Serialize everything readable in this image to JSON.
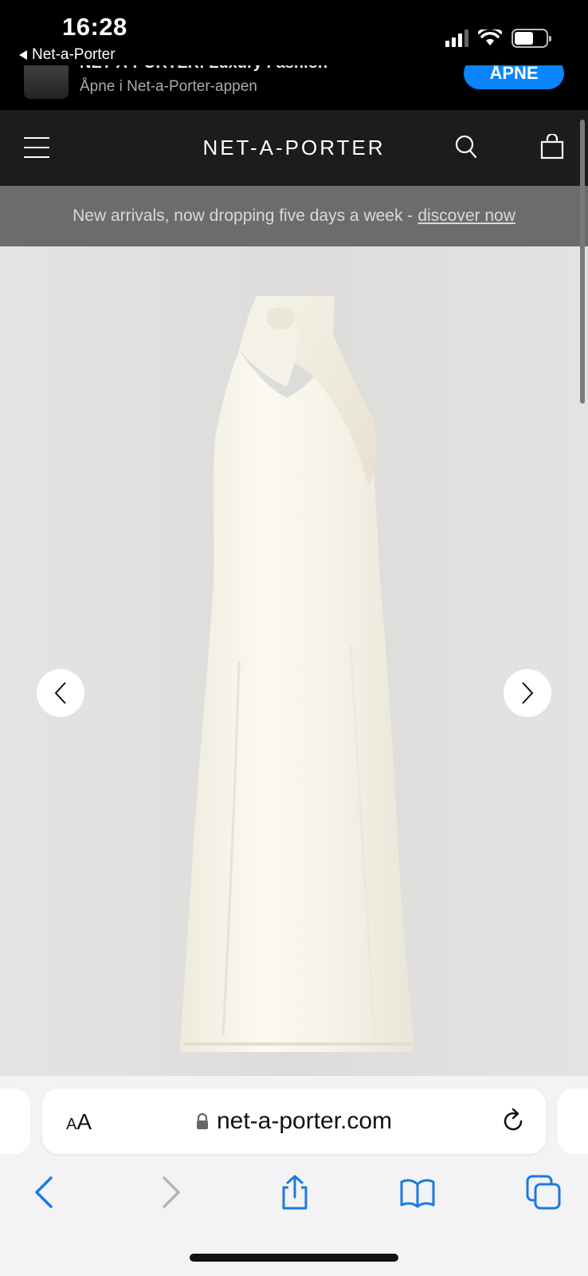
{
  "status_bar": {
    "time": "16:28",
    "back_app": "Net-a-Porter"
  },
  "app_banner": {
    "title": "NET-A-PORTER: Luxury Fashion",
    "subtitle": "Åpne i Net-a-Porter-appen",
    "open_label": "ÅPNE"
  },
  "header": {
    "logo": "NET-A-PORTER"
  },
  "promo": {
    "text": "New arrivals, now dropping five days a week -",
    "link": "discover now"
  },
  "browser": {
    "aa_small": "A",
    "aa_large": "A",
    "url": "net-a-porter.com"
  },
  "colors": {
    "accent": "#0a84ff",
    "header_bg": "#1c1c1c",
    "promo_bg": "#6c6c6c",
    "product_bg": "#e2e2e0",
    "toolbar_blue": "#1a7ae0"
  },
  "icons": {
    "menu": "hamburger-icon",
    "search": "search-icon",
    "bag": "shopping-bag-icon",
    "prev": "chevron-left-icon",
    "next": "chevron-right-icon",
    "lock": "lock-icon",
    "reload": "reload-icon",
    "back": "back-arrow-icon",
    "forward": "forward-arrow-icon",
    "share": "share-icon",
    "bookmarks": "bookmarks-icon",
    "tabs": "tabs-icon"
  }
}
